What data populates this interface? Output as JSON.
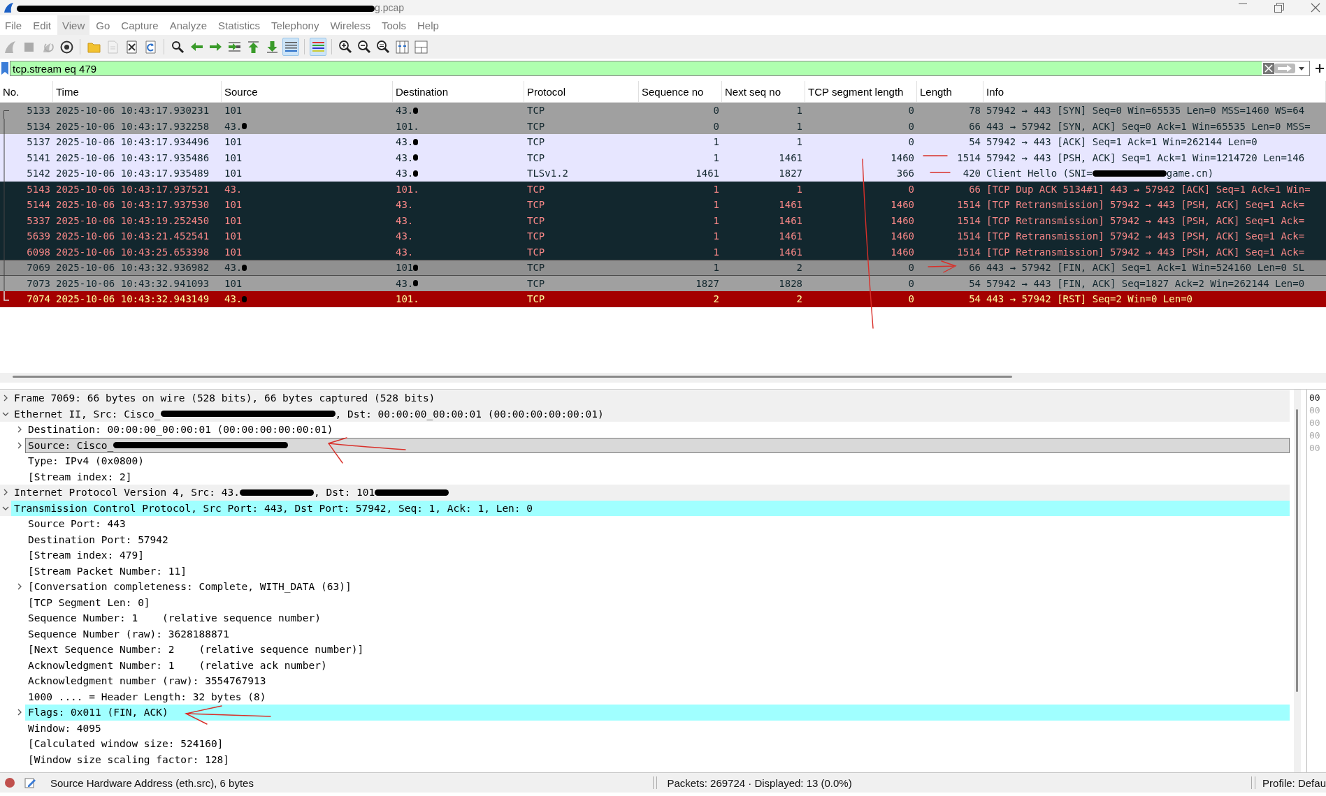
{
  "window": {
    "title": [
      {
        "kind": "redaction_wide"
      },
      {
        "kind": "text",
        "text": "g.pcap"
      }
    ]
  },
  "menu": [
    {
      "label": "File",
      "highlighted": false
    },
    {
      "label": "Edit",
      "highlighted": false
    },
    {
      "label": "View",
      "highlighted": true
    },
    {
      "label": "Go",
      "highlighted": false
    },
    {
      "label": "Capture",
      "highlighted": false
    },
    {
      "label": "Analyze",
      "highlighted": false
    },
    {
      "label": "Statistics",
      "highlighted": false
    },
    {
      "label": "Telephony",
      "highlighted": false
    },
    {
      "label": "Wireless",
      "highlighted": false
    },
    {
      "label": "Tools",
      "highlighted": false
    },
    {
      "label": "Help",
      "highlighted": false
    }
  ],
  "toolbar_groups": [
    [
      {
        "kind": "shark",
        "disabled": true,
        "pressed": false
      },
      {
        "kind": "stop",
        "disabled": true,
        "pressed": false
      },
      {
        "kind": "restart",
        "disabled": true,
        "pressed": false
      },
      {
        "kind": "options",
        "disabled": false,
        "pressed": false
      }
    ],
    [
      {
        "kind": "open",
        "disabled": false,
        "pressed": false
      },
      {
        "kind": "save",
        "disabled": true,
        "pressed": false
      },
      {
        "kind": "close",
        "disabled": false,
        "pressed": false
      },
      {
        "kind": "reload",
        "disabled": false,
        "pressed": false
      }
    ],
    [
      {
        "kind": "find",
        "disabled": false,
        "pressed": false
      },
      {
        "kind": "back",
        "disabled": false,
        "pressed": false
      },
      {
        "kind": "forward",
        "disabled": false,
        "pressed": false
      },
      {
        "kind": "goto",
        "disabled": false,
        "pressed": false
      },
      {
        "kind": "first",
        "disabled": false,
        "pressed": false
      },
      {
        "kind": "last",
        "disabled": false,
        "pressed": false
      },
      {
        "kind": "autoscroll",
        "disabled": false,
        "pressed": true
      }
    ],
    [
      {
        "kind": "colorize",
        "disabled": false,
        "pressed": true
      }
    ],
    [
      {
        "kind": "zoom_in",
        "disabled": false,
        "pressed": false
      },
      {
        "kind": "zoom_out",
        "disabled": false,
        "pressed": false
      },
      {
        "kind": "zoom_reset",
        "disabled": false,
        "pressed": false
      },
      {
        "kind": "resize_columns",
        "disabled": false,
        "pressed": false
      },
      {
        "kind": "layout",
        "disabled": false,
        "pressed": false
      }
    ]
  ],
  "filter": {
    "value": "tcp.stream eq 479"
  },
  "packet_list": {
    "columns": [
      {
        "label": "No.",
        "kind": "number"
      },
      {
        "label": "Time",
        "kind": "text"
      },
      {
        "label": "Source",
        "kind": "text"
      },
      {
        "label": "Destination",
        "kind": "text"
      },
      {
        "label": "Protocol",
        "kind": "text"
      },
      {
        "label": "Sequence no",
        "kind": "number"
      },
      {
        "label": "Next seq no",
        "kind": "number"
      },
      {
        "label": "TCP segment length",
        "kind": "number"
      },
      {
        "label": "Length",
        "kind": "number"
      },
      {
        "label": "Info",
        "kind": "text"
      }
    ],
    "rows": [
      {
        "kind": "tcp_syn_fin",
        "selected": false,
        "bracket_start": true,
        "bracket_end": false,
        "cells": [
          "5133",
          "2025-10-06 10:43:17.930231",
          "101",
          [
            {
              "kind": "text",
              "text": "43."
            },
            {
              "kind": "redaction_dot"
            }
          ],
          "TCP",
          "0",
          "1",
          "0",
          "78",
          "57942 → 443 [SYN] Seq=0 Win=65535 Len=0 MSS=1460 WS=64"
        ]
      },
      {
        "kind": "tcp_syn_fin",
        "selected": false,
        "bracket_start": false,
        "bracket_end": false,
        "cells": [
          "5134",
          "2025-10-06 10:43:17.932258",
          [
            {
              "kind": "text",
              "text": "43."
            },
            {
              "kind": "redaction_dot"
            }
          ],
          "101.",
          "TCP",
          "0",
          "1",
          "0",
          "66",
          "443 → 57942 [SYN, ACK] Seq=0 Ack=1 Win=65535 Len=0 MSS="
        ]
      },
      {
        "kind": "tcp",
        "selected": false,
        "bracket_start": false,
        "bracket_end": false,
        "cells": [
          "5137",
          "2025-10-06 10:43:17.934496",
          "101",
          [
            {
              "kind": "text",
              "text": "43."
            },
            {
              "kind": "redaction_dot"
            }
          ],
          "TCP",
          "1",
          "1",
          "0",
          "54",
          "57942 → 443 [ACK] Seq=1 Ack=1 Win=262144 Len=0"
        ]
      },
      {
        "kind": "tcp",
        "selected": false,
        "bracket_start": false,
        "bracket_end": false,
        "cells": [
          "5141",
          "2025-10-06 10:43:17.935486",
          "101",
          [
            {
              "kind": "text",
              "text": "43."
            },
            {
              "kind": "redaction_dot"
            }
          ],
          "TCP",
          "1",
          "1461",
          "1460",
          "1514",
          "57942 → 443 [PSH, ACK] Seq=1 Ack=1 Win=1214720 Len=146"
        ]
      },
      {
        "kind": "tcp",
        "selected": false,
        "bracket_start": false,
        "bracket_end": false,
        "cells": [
          "5142",
          "2025-10-06 10:43:17.935489",
          "101",
          [
            {
              "kind": "text",
              "text": "43."
            },
            {
              "kind": "redaction_dot"
            }
          ],
          "TLSv1.2",
          "1461",
          "1827",
          "366",
          "420",
          [
            {
              "kind": "text",
              "text": "Client Hello (SNI="
            },
            {
              "kind": "redaction_short"
            },
            {
              "kind": "text",
              "text": "game.cn)"
            }
          ]
        ]
      },
      {
        "kind": "bad_tcp",
        "selected": false,
        "bracket_start": false,
        "bracket_end": false,
        "cells": [
          "5143",
          "2025-10-06 10:43:17.937521",
          "43.",
          "101.",
          "TCP",
          "1",
          "1",
          "0",
          "66",
          "[TCP Dup ACK 5134#1] 443 → 57942 [ACK] Seq=1 Ack=1 Win="
        ]
      },
      {
        "kind": "bad_tcp",
        "selected": false,
        "bracket_start": false,
        "bracket_end": false,
        "cells": [
          "5144",
          "2025-10-06 10:43:17.937530",
          "101",
          "43.",
          "TCP",
          "1",
          "1461",
          "1460",
          "1514",
          "[TCP Retransmission] 57942 → 443 [PSH, ACK] Seq=1 Ack="
        ]
      },
      {
        "kind": "bad_tcp",
        "selected": false,
        "bracket_start": false,
        "bracket_end": false,
        "cells": [
          "5337",
          "2025-10-06 10:43:19.252450",
          "101",
          "43.",
          "TCP",
          "1",
          "1461",
          "1460",
          "1514",
          "[TCP Retransmission] 57942 → 443 [PSH, ACK] Seq=1 Ack="
        ]
      },
      {
        "kind": "bad_tcp",
        "selected": false,
        "bracket_start": false,
        "bracket_end": false,
        "cells": [
          "5639",
          "2025-10-06 10:43:21.452541",
          "101",
          "43.",
          "TCP",
          "1",
          "1461",
          "1460",
          "1514",
          "[TCP Retransmission] 57942 → 443 [PSH, ACK] Seq=1 Ack="
        ]
      },
      {
        "kind": "bad_tcp",
        "selected": false,
        "bracket_start": false,
        "bracket_end": false,
        "cells": [
          "6098",
          "2025-10-06 10:43:25.653398",
          "101",
          "43.",
          "TCP",
          "1",
          "1461",
          "1460",
          "1514",
          "[TCP Retransmission] 57942 → 443 [PSH, ACK] Seq=1 Ack="
        ]
      },
      {
        "kind": "tcp_syn_fin",
        "selected": true,
        "bracket_start": false,
        "bracket_end": false,
        "cells": [
          "7069",
          "2025-10-06 10:43:32.936982",
          [
            {
              "kind": "text",
              "text": "43."
            },
            {
              "kind": "redaction_dot"
            }
          ],
          [
            {
              "kind": "text",
              "text": "101"
            },
            {
              "kind": "redaction_dot"
            }
          ],
          "TCP",
          "1",
          "2",
          "0",
          "66",
          "443 → 57942 [FIN, ACK] Seq=1 Ack=1 Win=524160 Len=0 SL"
        ]
      },
      {
        "kind": "tcp_syn_fin",
        "selected": false,
        "bracket_start": false,
        "bracket_end": false,
        "cells": [
          "7073",
          "2025-10-06 10:43:32.941093",
          "101",
          [
            {
              "kind": "text",
              "text": "43."
            },
            {
              "kind": "redaction_dot"
            }
          ],
          "TCP",
          "1827",
          "1828",
          "0",
          "54",
          "57942 → 443 [FIN, ACK] Seq=1827 Ack=2 Win=262144 Len=0"
        ]
      },
      {
        "kind": "tcp_rst",
        "selected": false,
        "bracket_start": false,
        "bracket_end": true,
        "cells": [
          "7074",
          "2025-10-06 10:43:32.943149",
          [
            {
              "kind": "text",
              "text": "43."
            },
            {
              "kind": "redaction_dot"
            }
          ],
          "101.",
          "TCP",
          "2",
          "2",
          "0",
          "54",
          "443 → 57942 [RST] Seq=2 Win=0 Len=0"
        ]
      }
    ]
  },
  "details": [
    {
      "expandable": true,
      "expanded": false,
      "selected": false,
      "highlighted": false,
      "label": "Frame 7069: 66 bytes on wire (528 bits), 66 bytes captured (528 bits)"
    },
    {
      "expandable": true,
      "expanded": true,
      "selected": false,
      "highlighted": false,
      "label": [
        {
          "kind": "text",
          "text": "Ethernet II, Src: Cisco_"
        },
        {
          "kind": "redaction_long"
        },
        {
          "kind": "text",
          "text": ", Dst: 00:00:00_00:00:01 (00:00:00:00:00:01)"
        }
      ],
      "children": [
        {
          "expandable": true,
          "expanded": false,
          "selected": false,
          "highlighted": false,
          "label": "Destination: 00:00:00_00:00:01 (00:00:00:00:00:01)"
        },
        {
          "expandable": true,
          "expanded": false,
          "selected": true,
          "highlighted": false,
          "label": [
            {
              "kind": "text",
              "text": "Source: Cisco_"
            },
            {
              "kind": "redaction_long"
            }
          ]
        },
        {
          "expandable": false,
          "selected": false,
          "highlighted": false,
          "label": "Type: IPv4 (0x0800)"
        },
        {
          "expandable": false,
          "selected": false,
          "highlighted": false,
          "label": "[Stream index: 2]"
        }
      ]
    },
    {
      "expandable": true,
      "expanded": false,
      "selected": false,
      "highlighted": false,
      "label": [
        {
          "kind": "text",
          "text": "Internet Protocol Version 4, Src: 43."
        },
        {
          "kind": "redaction_short"
        },
        {
          "kind": "text",
          "text": ", Dst: 101"
        },
        {
          "kind": "redaction_short"
        }
      ]
    },
    {
      "expandable": true,
      "expanded": true,
      "selected": false,
      "highlighted": true,
      "label": "Transmission Control Protocol, Src Port: 443, Dst Port: 57942, Seq: 1, Ack: 1, Len: 0",
      "children": [
        {
          "expandable": false,
          "selected": false,
          "highlighted": false,
          "label": "Source Port: 443"
        },
        {
          "expandable": false,
          "selected": false,
          "highlighted": false,
          "label": "Destination Port: 57942"
        },
        {
          "expandable": false,
          "selected": false,
          "highlighted": false,
          "label": "[Stream index: 479]"
        },
        {
          "expandable": false,
          "selected": false,
          "highlighted": false,
          "label": "[Stream Packet Number: 11]"
        },
        {
          "expandable": true,
          "expanded": false,
          "selected": false,
          "highlighted": false,
          "label": "[Conversation completeness: Complete, WITH_DATA (63)]"
        },
        {
          "expandable": false,
          "selected": false,
          "highlighted": false,
          "label": "[TCP Segment Len: 0]"
        },
        {
          "expandable": false,
          "selected": false,
          "highlighted": false,
          "label": "Sequence Number: 1    (relative sequence number)"
        },
        {
          "expandable": false,
          "selected": false,
          "highlighted": false,
          "label": "Sequence Number (raw): 3628188871"
        },
        {
          "expandable": false,
          "selected": false,
          "highlighted": false,
          "label": "[Next Sequence Number: 2    (relative sequence number)]"
        },
        {
          "expandable": false,
          "selected": false,
          "highlighted": false,
          "label": "Acknowledgment Number: 1    (relative ack number)"
        },
        {
          "expandable": false,
          "selected": false,
          "highlighted": false,
          "label": "Acknowledgment number (raw): 3554767913"
        },
        {
          "expandable": false,
          "selected": false,
          "highlighted": false,
          "label": "1000 .... = Header Length: 32 bytes (8)"
        },
        {
          "expandable": true,
          "expanded": false,
          "selected": false,
          "highlighted": true,
          "label": "Flags: 0x011 (FIN, ACK)"
        },
        {
          "expandable": false,
          "selected": false,
          "highlighted": false,
          "label": "Window: 4095"
        },
        {
          "expandable": false,
          "selected": false,
          "highlighted": false,
          "label": "[Calculated window size: 524160]"
        },
        {
          "expandable": false,
          "selected": false,
          "highlighted": false,
          "label": "[Window size scaling factor: 128]"
        }
      ]
    }
  ],
  "bytes_pane": [
    {
      "text": "00",
      "selected": true
    },
    {
      "text": "00",
      "selected": false
    },
    {
      "text": "00",
      "selected": false
    },
    {
      "text": "00",
      "selected": false
    },
    {
      "text": "00",
      "selected": false
    }
  ],
  "status_bar": {
    "field_info": "Source Hardware Address (eth.src), 6 bytes",
    "packets": "Packets: 269724 · Displayed: 13 (0.0%)",
    "profile": "Profile: Defau"
  }
}
